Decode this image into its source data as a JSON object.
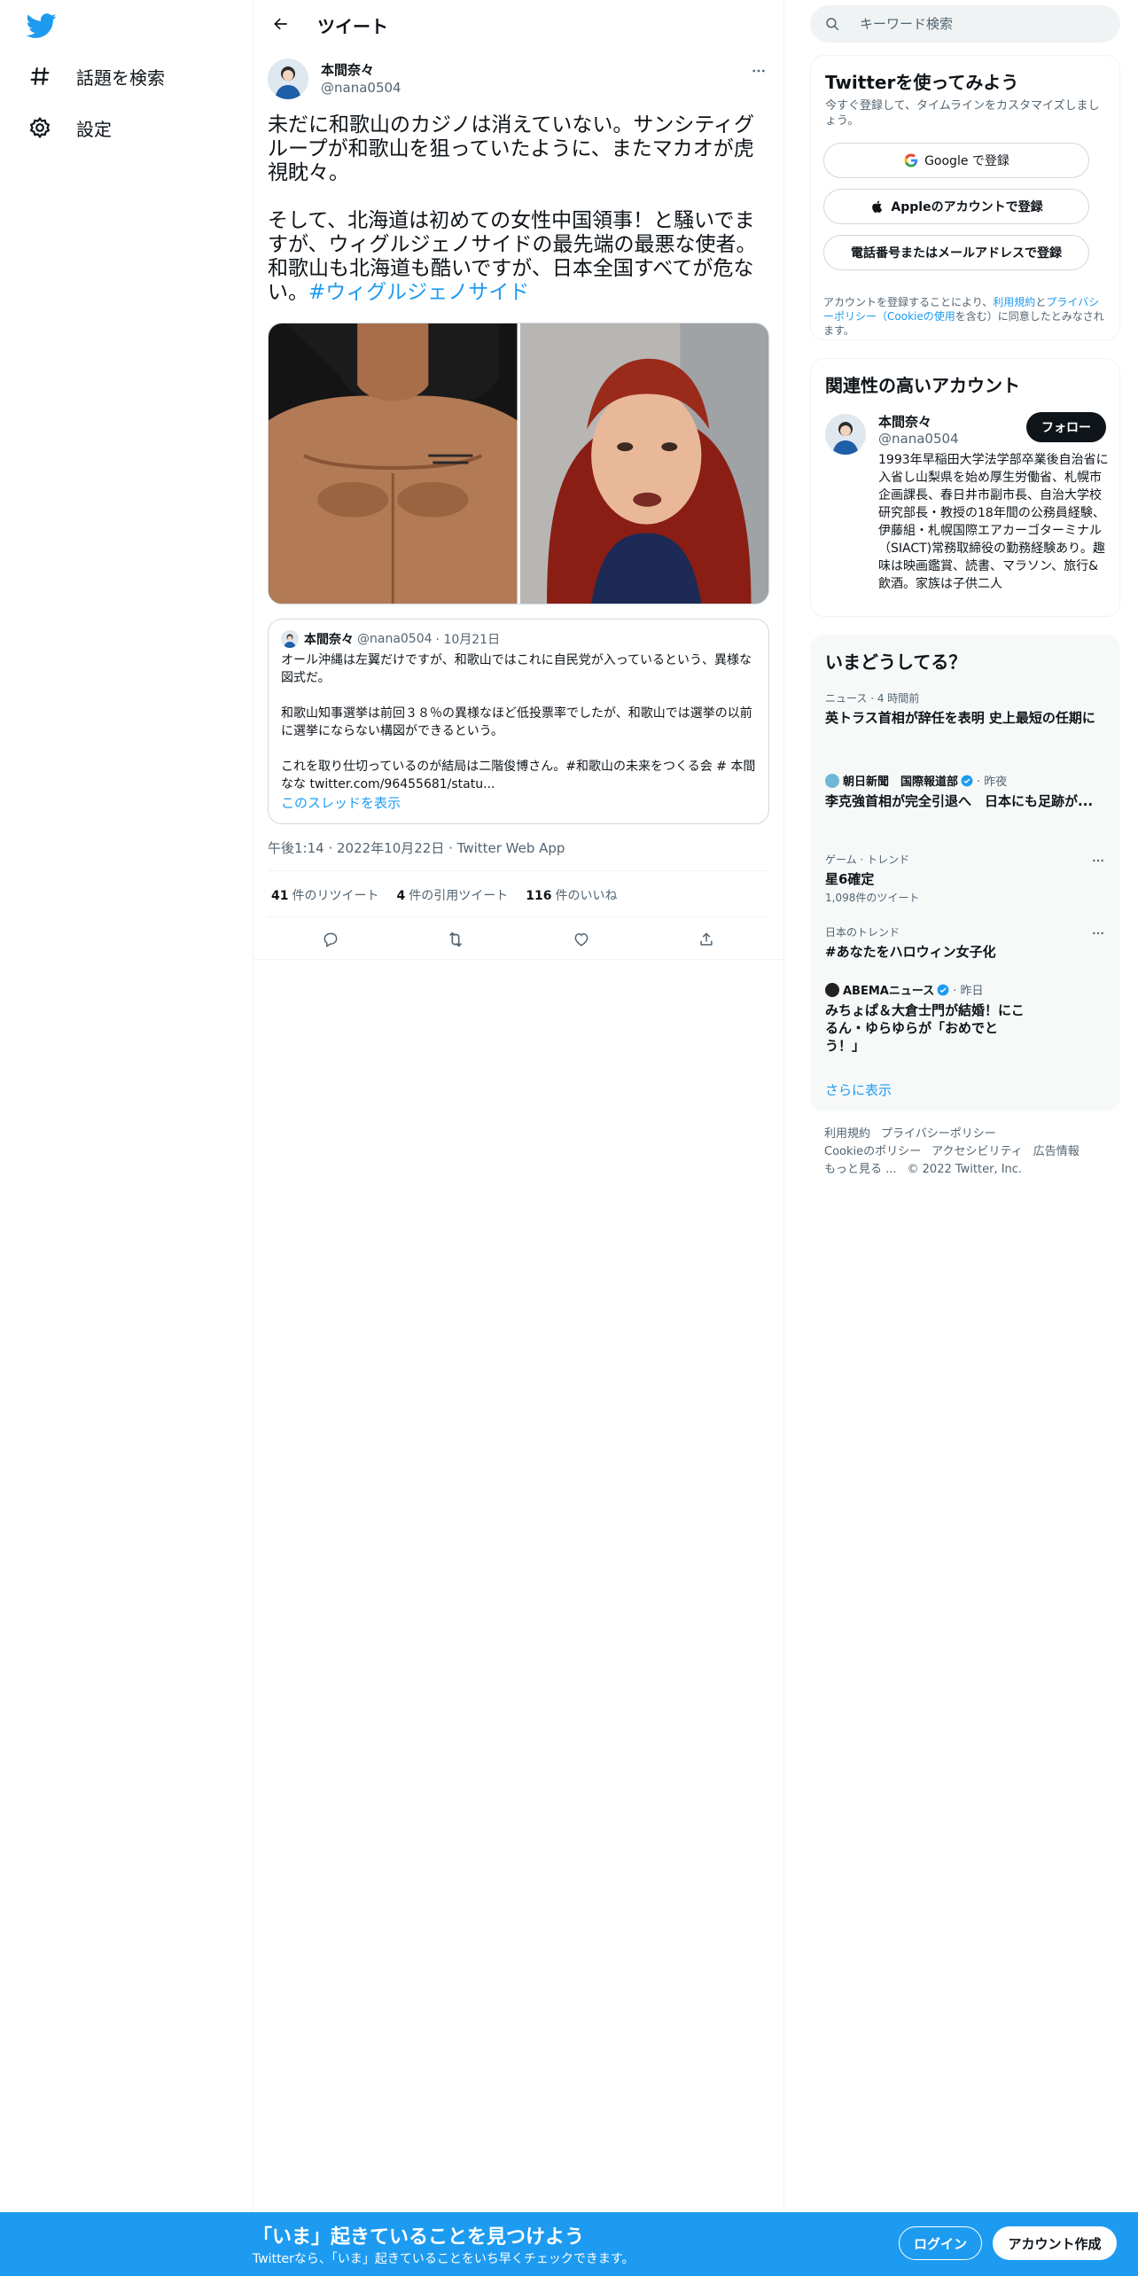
{
  "nav": {
    "logo_icon": "twitter-bird-icon",
    "items": [
      {
        "label": "話題を検索",
        "icon": "hashtag-icon"
      },
      {
        "label": "設定",
        "icon": "gear-icon"
      }
    ]
  },
  "header": {
    "title": "ツイート",
    "back_icon": "arrow-left-icon"
  },
  "tweet": {
    "author_name": "本間奈々",
    "author_handle": "@nana0504",
    "text_main": "未だに和歌山のカジノは消えていない。サンシティグループが和歌山を狙っていたように、またマカオが虎視眈々。\n\nそして、北海道は初めての女性中国領事！と騒いでますが、ウィグルジェノサイドの最先端の最悪な使者。和歌山も北海道も酷いですが、日本全国すべてが危ない。",
    "hashtag": "#ウィグルジェノサイド",
    "meta": "午後1:14 · 2022年10月22日 · Twitter Web App",
    "stats": {
      "retweets": "41",
      "retweets_label": "件のリツイート",
      "quotes": "4",
      "quotes_label": "件の引用ツイート",
      "likes": "116",
      "likes_label": "件のいいね"
    }
  },
  "quote": {
    "author_name": "本間奈々",
    "author_handle": "@nana0504",
    "date": "· 10月21日",
    "text": "オール沖縄は左翼だけですが、和歌山ではこれに自民党が入っているという、異様な図式だ。\n\n和歌山知事選挙は前回３８％の異様なほど低投票率でしたが、和歌山では選挙の以前に選挙にならない構図ができるという。\n\nこれを取り仕切っているのが結局は二階俊博さん。#和歌山の未来をつくる会 # 本間なな twitter.com/96455681/statu...",
    "thread_link": "このスレッドを表示"
  },
  "search": {
    "placeholder": "キーワード検索"
  },
  "signup": {
    "title": "Twitterを使ってみよう",
    "subtitle": "今すぐ登録して、タイムラインをカスタマイズしましょう。",
    "google": "Google で登録",
    "apple": "Appleのアカウントで登録",
    "phone": "電話番号またはメールアドレスで登録",
    "terms_pre": "アカウントを登録することにより、",
    "terms_link1": "利用規約",
    "terms_mid": "と",
    "terms_link2": "プライバシーポリシー（Cookieの使用",
    "terms_post": "を含む）に同意したとみなされます。"
  },
  "related": {
    "title": "関連性の高いアカウント",
    "name": "本間奈々",
    "handle": "@nana0504",
    "follow": "フォロー",
    "bio": "1993年早稲田大学法学部卒業後自治省に入省し山梨県を始め厚生労働省、札幌市企画課長、春日井市副市長、自治大学校研究部長・教授の18年間の公務員経験、伊藤組・札幌国際エアカーゴターミナル（SIACT)常務取締役の勤務経験あり。趣味は映画鑑賞、読書、マラソン、旅行&飲酒。家族は子供二人"
  },
  "trends": {
    "title": "いまどうしてる？",
    "items": [
      {
        "category": "ニュース · 4 時間前",
        "topic": "英トラス首相が辞任を表明 史上最短の任期に"
      },
      {
        "source": "朝日新聞　国際報道部",
        "time": "· 昨夜",
        "topic": "李克強首相が完全引退へ　日本にも足跡が..."
      },
      {
        "category": "ゲーム · トレンド",
        "topic": "星6確定",
        "count": "1,098件のツイート"
      },
      {
        "category": "日本のトレンド",
        "topic": "#あなたをハロウィン女子化"
      },
      {
        "source": "ABEMAニュース",
        "time": "· 昨日",
        "topic": "みちょぱ＆大倉士門が結婚！にこるん・ゆらゆらが「おめでとう！」"
      }
    ],
    "show_more": "さらに表示"
  },
  "footer": {
    "links": [
      "利用規約",
      "プライバシーポリシー",
      "Cookieのポリシー",
      "アクセシビリティ",
      "広告情報",
      "もっと見る ...",
      "© 2022 Twitter, Inc."
    ]
  },
  "banner": {
    "title": "「いま」起きていることを見つけよう",
    "subtitle": "Twitterなら、「いま」起きていることをいち早くチェックできます。",
    "login": "ログイン",
    "register": "アカウント作成"
  },
  "colors": {
    "accent": "#1d9bf0",
    "text": "#0f1419",
    "muted": "#536471"
  }
}
